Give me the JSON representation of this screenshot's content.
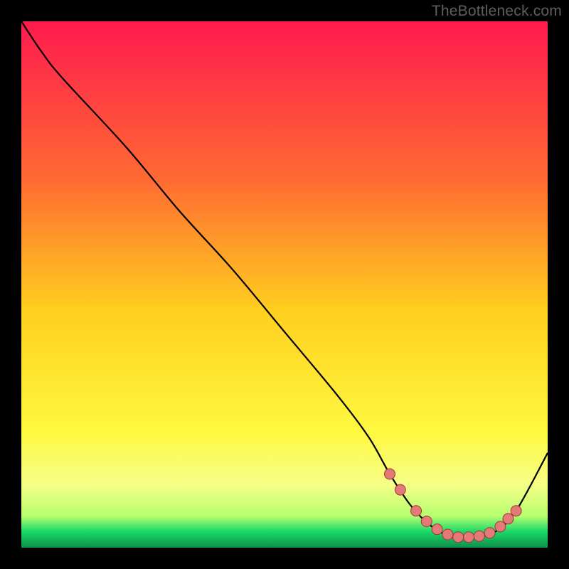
{
  "watermark": "TheBottleneck.com",
  "colors": {
    "bg_black": "#000000",
    "curve": "#000000",
    "marker_fill": "#e47a78",
    "marker_stroke": "#a03838",
    "grad_top": "#ff1a4e",
    "grad_mid1": "#ff8b2e",
    "grad_mid2": "#ffe424",
    "grad_band": "#f8ff7a",
    "grad_green": "#17d867",
    "grad_bottom": "#0f8f49"
  },
  "plot": {
    "inner_x": 30,
    "inner_y": 30,
    "inner_w": 740,
    "inner_h": 740
  },
  "chart_data": {
    "type": "line",
    "title": "",
    "xlabel": "",
    "ylabel": "",
    "xlim": [
      0,
      100
    ],
    "ylim": [
      0,
      100
    ],
    "series": [
      {
        "name": "bottleneck-curve",
        "x": [
          0,
          4,
          8,
          20,
          30,
          40,
          50,
          60,
          66,
          70,
          74,
          78,
          82,
          86,
          90,
          94,
          100
        ],
        "y": [
          100,
          94,
          89,
          76,
          64,
          53,
          41,
          29,
          21,
          14,
          8,
          4,
          2,
          2,
          3,
          7,
          18
        ]
      }
    ],
    "markers": {
      "name": "highlight-points",
      "x": [
        70,
        72,
        75,
        77,
        79,
        81,
        83,
        85,
        87,
        89,
        91,
        92.5,
        94
      ],
      "y": [
        14,
        11,
        7,
        5,
        3.5,
        2.5,
        2,
        2,
        2.2,
        2.8,
        4,
        5.5,
        7
      ]
    }
  }
}
